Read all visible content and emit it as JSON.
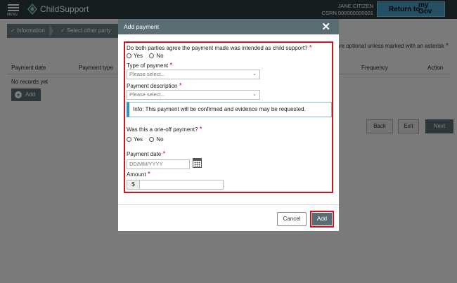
{
  "header": {
    "menu_label": "MENU",
    "app_name": "ChildSupport",
    "user_name": "JANE CITIZEN",
    "user_crn": "CSRN 000000000001",
    "return_label": "Return to",
    "mygov_line1": "my",
    "mygov_line2": "Gov"
  },
  "breadcrumb": {
    "items": [
      {
        "label": "Information",
        "icon": "check-icon"
      },
      {
        "label": "Select other party",
        "icon": "check-icon"
      }
    ]
  },
  "page": {
    "required_note": "are optional unless marked with an asterisk",
    "table_headers": [
      "Payment date",
      "Payment type",
      "Frequency",
      "Action"
    ],
    "no_records": "No records yet",
    "add_label": "Add",
    "back_label": "Back",
    "exit_label": "Exit",
    "next_label": "Next"
  },
  "modal": {
    "title": "Add payment",
    "close_icon": "close-icon",
    "q_intended": "Do both parties agree the payment made was intended as child support?",
    "yes": "Yes",
    "no": "No",
    "type_label": "Type of payment",
    "type_placeholder": "Please select...",
    "desc_label": "Payment description",
    "desc_placeholder": "Please select...",
    "info_text": "Info: This payment will be confirmed and evidence may be requested.",
    "q_oneoff": "Was this a one-off payment?",
    "date_label": "Payment date",
    "date_placeholder": "DD/MM/YYYY",
    "amount_label": "Amount",
    "currency": "$",
    "cancel_label": "Cancel",
    "add_label": "Add"
  },
  "colors": {
    "header_bg": "#2b3a3f",
    "accent": "#5a6d73",
    "highlight": "#d4151e",
    "required_star": "#c8102e",
    "mygov_blue": "#4a9fc4"
  }
}
